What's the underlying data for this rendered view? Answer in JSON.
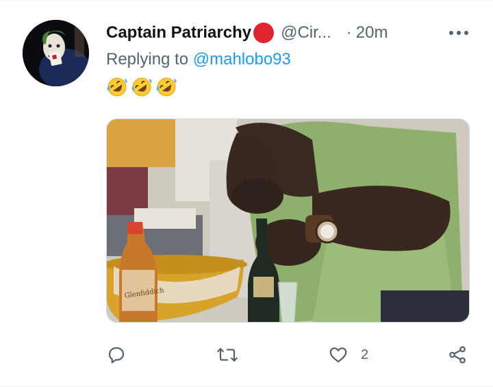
{
  "tweet": {
    "display_name": "Captain Patriarchy",
    "handle": "@Cir...",
    "separator": "·",
    "time": "20m",
    "replying_prefix": "Replying to ",
    "replying_mention": "@mahlobo93",
    "emojis": [
      "rolling-on-floor-laughing-emoji",
      "rolling-on-floor-laughing-emoji",
      "rolling-on-floor-laughing-emoji"
    ],
    "avatar_icon": "joker-avatar",
    "badge_color": "#e0242d"
  },
  "actions": {
    "reply_icon": "reply-icon",
    "retweet_icon": "retweet-icon",
    "like_icon": "heart-icon",
    "like_count": "2",
    "share_icon": "share-icon"
  },
  "media": {
    "bottle_label": "Glenfiddich"
  },
  "colors": {
    "text": "#0f1419",
    "secondary": "#536471",
    "link": "#1d9bf0"
  }
}
